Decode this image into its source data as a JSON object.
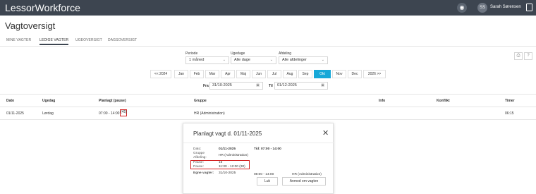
{
  "app": {
    "name": "LessorWorkforce"
  },
  "user": {
    "initials": "SS",
    "name": "Sarah Sørensen"
  },
  "icons": {
    "help": "help-circle-icon",
    "logout": "logout-icon",
    "print": "print-icon",
    "question": "question-icon",
    "calendar": "calendar-icon",
    "chevron": "chevron-down-icon",
    "close": "close-icon"
  },
  "page": {
    "title": "Vagtoversigt"
  },
  "tabs": [
    {
      "label": "MINE VAGTER",
      "active": false
    },
    {
      "label": "LEDIGE VAGTER",
      "active": true
    },
    {
      "label": "UGEOVERSIGT",
      "active": false
    },
    {
      "label": "DAGSOVERSIGT",
      "active": false
    }
  ],
  "filters": {
    "periode": {
      "label": "Periode",
      "value": "1 måned"
    },
    "ugedage": {
      "label": "Ugedage",
      "value": "Alle dage"
    },
    "afdeling": {
      "label": "Afdeling",
      "value": "Alle afdelinger"
    }
  },
  "months": {
    "prev": "<< 2024",
    "items": [
      "Jan",
      "Feb",
      "Mar",
      "Apr",
      "Maj",
      "Jun",
      "Jul",
      "Aug",
      "Sep",
      "Okt",
      "Nov",
      "Dec"
    ],
    "active": "Okt",
    "next": "2026 >>"
  },
  "dates": {
    "fra_label": "Fra",
    "fra_value": "31/10-2025",
    "til_label": "Til",
    "til_value": "01/12-2025"
  },
  "table": {
    "headers": [
      "Dato",
      "Ugedag",
      "Planlagt (pause)",
      "Gruppe",
      "Info",
      "Konflikt",
      "Timer"
    ],
    "rows": [
      {
        "dato": "01/11-2025",
        "ugedag": "Lørdag",
        "planlagt": "07:00 - 14:00",
        "pause": "(45)",
        "gruppe": "HR (Administration)",
        "info": "",
        "konflikt": "",
        "timer": "06:15"
      }
    ]
  },
  "modal": {
    "title": "Planlagt vagt d. 01/11-2025",
    "dato_label": "Dato:",
    "dato_value": "01/11-2025",
    "tid_label": "Tid:",
    "tid_value": "07:00 - 14:00",
    "gruppe_label": "Gruppe",
    "gruppe_value": "HR (Administration)",
    "afdeling_label": "Afdeling:",
    "pause1_label": "Pause:",
    "pause1_value": "15",
    "pause2_label": "Pause:",
    "pause2_value": "11:30 - 12:00 (30)",
    "egne_label": "Egne vagter:",
    "egne_date": "31/10-2025",
    "egne_time": "08:00 - 14:00",
    "egne_group": "HR (Administration)",
    "close_label": "Luk",
    "request_label": "Anmod om vagten"
  }
}
